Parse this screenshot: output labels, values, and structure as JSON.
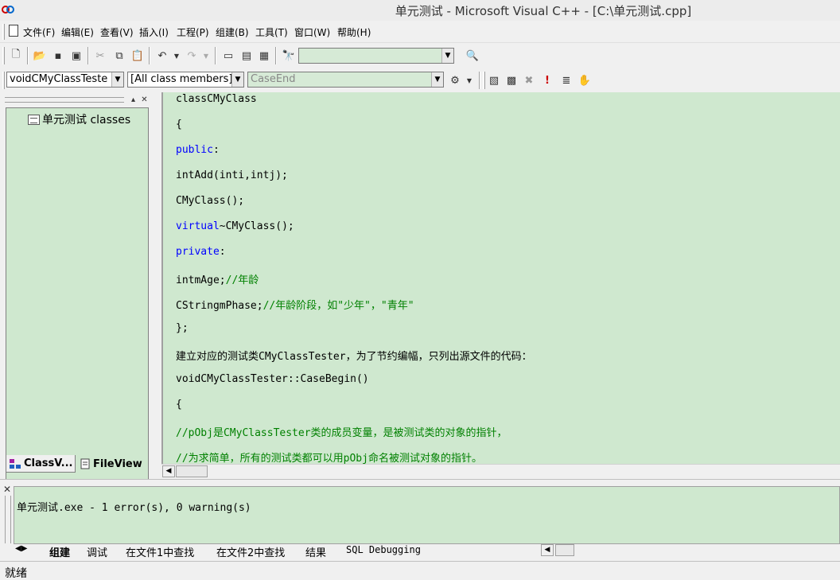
{
  "window": {
    "title": "单元测试 - Microsoft Visual C++ - [C:\\单元测试.cpp]"
  },
  "menu": {
    "items": [
      "文件(F)",
      "编辑(E)",
      "查看(V)",
      "插入(I)",
      "工程(P)",
      "组建(B)",
      "工具(T)",
      "窗口(W)",
      "帮助(H)"
    ]
  },
  "wizardbar": {
    "class_combo": "voidCMyClassTeste",
    "members_combo": "[All class members]",
    "function_combo": "CaseEnd"
  },
  "workspace": {
    "tree_root": "单元测试 classes",
    "tabs": [
      "ClassV...",
      "FileView"
    ]
  },
  "editor": {
    "lines": [
      {
        "segments": [
          {
            "t": "classCMyClass",
            "c": ""
          }
        ]
      },
      {
        "segments": [
          {
            "t": "{",
            "c": ""
          }
        ]
      },
      {
        "segments": [
          {
            "t": "public",
            "c": "kw"
          },
          {
            "t": ":",
            "c": ""
          }
        ]
      },
      {
        "segments": [
          {
            "t": "intAdd(inti,intj);",
            "c": ""
          }
        ]
      },
      {
        "segments": [
          {
            "t": "CMyClass();",
            "c": ""
          }
        ]
      },
      {
        "segments": [
          {
            "t": "virtual",
            "c": "kw"
          },
          {
            "t": "~CMyClass();",
            "c": ""
          }
        ]
      },
      {
        "segments": [
          {
            "t": "private",
            "c": "kw"
          },
          {
            "t": ":",
            "c": ""
          }
        ]
      },
      {
        "segments": [
          {
            "t": "intmAge;",
            "c": ""
          },
          {
            "t": "//年龄",
            "c": "cmt"
          }
        ]
      },
      {
        "segments": [
          {
            "t": "CStringmPhase;",
            "c": ""
          },
          {
            "t": "//年龄阶段，如\"少年\"，\"青年\"",
            "c": "cmt"
          }
        ]
      },
      {
        "segments": [
          {
            "t": "};",
            "c": ""
          }
        ]
      },
      {
        "segments": [
          {
            "t": "建立对应的测试类CMyClassTester，为了节约编幅，只列出源文件的代码：",
            "c": ""
          }
        ]
      },
      {
        "segments": [
          {
            "t": "voidCMyClassTester::CaseBegin()",
            "c": ""
          }
        ]
      },
      {
        "segments": [
          {
            "t": "{",
            "c": ""
          }
        ]
      },
      {
        "segments": [
          {
            "t": "//pObj是CMyClassTester类的成员变量，是被测试类的对象的指针，",
            "c": "cmt"
          }
        ]
      },
      {
        "segments": [
          {
            "t": "//为求简单，所有的测试类都可以用pObj命名被测试对象的指针。",
            "c": "cmt"
          }
        ]
      }
    ]
  },
  "output": {
    "text": "单元测试.exe - 1 error(s), 0 warning(s)",
    "tabs": [
      "组建",
      "调试",
      "在文件1中查找",
      "在文件2中查找",
      "结果",
      "SQL Debugging"
    ]
  },
  "status": {
    "text": "就绪"
  },
  "icons": {
    "new": "new-document-icon",
    "open": "open-folder-icon",
    "save": "save-icon",
    "save_all": "save-all-icon",
    "cut": "cut-icon",
    "copy": "copy-icon",
    "paste": "paste-icon",
    "undo": "undo-icon",
    "redo": "redo-icon",
    "workspace": "workspace-icon",
    "output": "output-window-icon",
    "windows": "window-list-icon",
    "find_files": "find-in-files-icon",
    "search": "search-icon",
    "wizard": "wizard-action-icon",
    "compile": "compile-icon",
    "build": "build-icon",
    "stop_build": "stop-build-icon",
    "execute": "execute-icon",
    "go": "go-icon",
    "breakpoint": "breakpoint-icon"
  }
}
